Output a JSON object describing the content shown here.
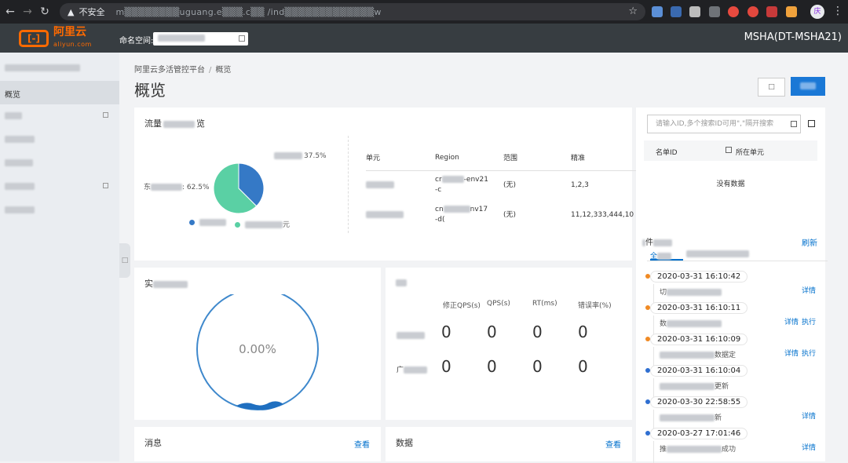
{
  "browser": {
    "security_label": "不安全",
    "url": "m▒▒▒▒▒▒▒▒uguang.e▒▒▒.c▒▒ /ind▒▒▒▒▒▒▒▒▒▒▒▒▒w",
    "profile_initial": "庆"
  },
  "header": {
    "logo_text": "阿里云",
    "logo_sub": "aliyun.com",
    "namespace_label": "命名空间:",
    "namespace_value": "",
    "region": "MSHA(DT-MSHA21)"
  },
  "sidebar": {
    "items": [
      {
        "label": "概览",
        "active": true
      }
    ]
  },
  "breadcrumb": {
    "root": "阿里云多活管控平台",
    "current": "概览"
  },
  "page": {
    "title": "概览"
  },
  "traffic_card": {
    "title_prefix": "流量",
    "title_suffix": "览",
    "pie": {
      "slices": [
        {
          "label_suffix": "37.5%",
          "percent": 37.5,
          "color": "#3579c6"
        },
        {
          "label_prefix": "东",
          "label_suffix": ": 62.5%",
          "percent": 62.5,
          "color": "#5ad0a4"
        }
      ],
      "legend_suffix_2": "元"
    },
    "table": {
      "headers": [
        "单元",
        "Region",
        "范围",
        "精准"
      ],
      "rows": [
        {
          "region_prefix": "cr",
          "region_suffix": "-env21",
          "region_line2": "-c",
          "scope": "(无)",
          "precise": "1,2,3"
        },
        {
          "region_prefix": "cn",
          "region_suffix": "nv17",
          "region_line2": "-d(",
          "scope": "(无)",
          "precise": "11,12,333,444,10"
        }
      ]
    }
  },
  "realtime_card": {
    "title_prefix": "实",
    "gauge_value": 0.0,
    "gauge_text": "0.00%"
  },
  "metrics_card": {
    "headers": [
      "修正QPS(s)",
      "QPS(s)",
      "RT(ms)",
      "错误率(%)"
    ],
    "rows": [
      {
        "values": [
          "0",
          "0",
          "0",
          "0"
        ]
      },
      {
        "label_prefix": "广",
        "values": [
          "0",
          "0",
          "0",
          "0"
        ]
      }
    ]
  },
  "message_card": {
    "title": "消息",
    "link": "查看"
  },
  "data_card": {
    "title": "数据",
    "link": "查看"
  },
  "blacklist": {
    "search_placeholder": "请输入ID,多个搜索ID可用\",\"隔开搜索",
    "col_name": "名单ID",
    "col_unit": "所在单元",
    "empty": "没有数据"
  },
  "events": {
    "title_suffix": "件",
    "refresh": "刷新",
    "tab_all": "全",
    "items": [
      {
        "time": "2020-03-31 16:10:42",
        "color": "#f08a24",
        "desc_prefix": "切",
        "actions": [
          "详情"
        ]
      },
      {
        "time": "2020-03-31 16:10:11",
        "color": "#f08a24",
        "desc_prefix": "数",
        "actions": [
          "详情",
          "执行"
        ]
      },
      {
        "time": "2020-03-31 16:10:09",
        "color": "#f08a24",
        "desc_prefix": "",
        "desc_suffix": "数据定",
        "actions": [
          "详情",
          "执行"
        ]
      },
      {
        "time": "2020-03-31 16:10:04",
        "color": "#2f6fd1",
        "desc_prefix": "",
        "desc_suffix": "更新",
        "actions": []
      },
      {
        "time": "2020-03-30 22:58:55",
        "color": "#2f6fd1",
        "desc_prefix": "",
        "desc_suffix": "新",
        "actions": [
          "详情"
        ]
      },
      {
        "time": "2020-03-27 17:01:46",
        "color": "#2f6fd1",
        "desc_prefix": "推",
        "desc_suffix": "成功",
        "actions": [
          "详情"
        ]
      }
    ]
  }
}
